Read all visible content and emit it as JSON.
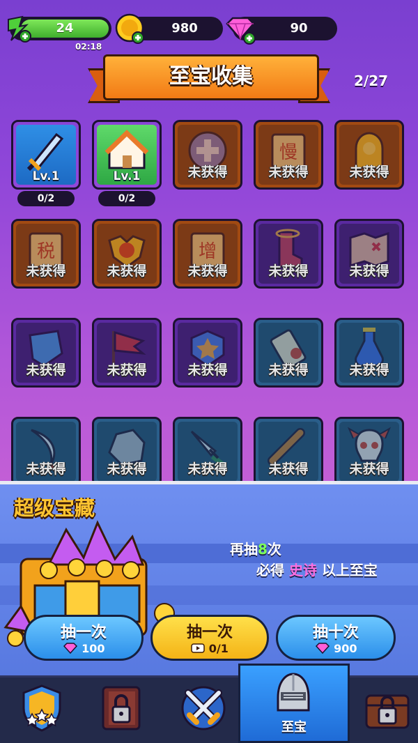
{
  "resources": {
    "energy": {
      "value": "24",
      "timer": "02:18"
    },
    "gold": {
      "value": "980"
    },
    "gems": {
      "value": "90"
    }
  },
  "header": {
    "title": "至宝收集",
    "progress": "2/27"
  },
  "collection": {
    "items": [
      {
        "icon": "sword-icon",
        "rarity": "blue",
        "owned": true,
        "level": "Lv.1",
        "count": "0/2"
      },
      {
        "icon": "house-icon",
        "rarity": "green",
        "owned": true,
        "level": "Lv.1",
        "count": "0/2"
      },
      {
        "icon": "medical-plus-icon",
        "rarity": "orange",
        "owned": false,
        "status": "未获得"
      },
      {
        "icon": "slow-scroll-icon",
        "rarity": "orange",
        "owned": false,
        "status": "未获得"
      },
      {
        "icon": "golden-armor-icon",
        "rarity": "orange",
        "owned": false,
        "status": "未获得"
      },
      {
        "icon": "tax-scroll-icon",
        "rarity": "orange",
        "owned": false,
        "status": "未获得"
      },
      {
        "icon": "trophy-emblem-icon",
        "rarity": "orange",
        "owned": false,
        "status": "未获得"
      },
      {
        "icon": "increase-scroll-icon",
        "rarity": "orange",
        "owned": false,
        "status": "未获得"
      },
      {
        "icon": "winged-boot-icon",
        "rarity": "purple",
        "owned": false,
        "status": "未获得"
      },
      {
        "icon": "treasure-map-icon",
        "rarity": "purple",
        "owned": false,
        "status": "未获得"
      },
      {
        "icon": "shield-icon",
        "rarity": "purple",
        "owned": false,
        "status": "未获得"
      },
      {
        "icon": "flag-icon",
        "rarity": "purple",
        "owned": false,
        "status": "未获得"
      },
      {
        "icon": "star-badge-icon",
        "rarity": "purple",
        "owned": false,
        "status": "未获得"
      },
      {
        "icon": "scroll-icon",
        "rarity": "teal",
        "owned": false,
        "status": "未获得"
      },
      {
        "icon": "potion-icon",
        "rarity": "teal",
        "owned": false,
        "status": "未获得"
      },
      {
        "icon": "curved-blade-icon",
        "rarity": "teal",
        "owned": false,
        "status": "未获得"
      },
      {
        "icon": "rock-icon",
        "rarity": "teal",
        "owned": false,
        "status": "未获得"
      },
      {
        "icon": "dagger-icon",
        "rarity": "teal",
        "owned": false,
        "status": "未获得"
      },
      {
        "icon": "telescope-icon",
        "rarity": "teal",
        "owned": false,
        "status": "未获得"
      },
      {
        "icon": "demon-skull-icon",
        "rarity": "teal",
        "owned": false,
        "status": "未获得"
      }
    ]
  },
  "treasure": {
    "title": "超级宝藏",
    "hint_prefix": "再抽",
    "hint_count": "8",
    "hint_suffix": "次",
    "hint2_prefix": "必得",
    "hint2_rarity": "史诗",
    "hint2_suffix": "以上至宝",
    "buttons": [
      {
        "label": "抽一次",
        "cost": "100",
        "cost_icon": "gem-icon"
      },
      {
        "label": "抽一次",
        "cost": "0/1",
        "cost_icon": "video-icon"
      },
      {
        "label": "抽十次",
        "cost": "900",
        "cost_icon": "gem-icon"
      }
    ]
  },
  "nav": {
    "tabs": [
      {
        "icon": "stars-shield-icon",
        "label": ""
      },
      {
        "icon": "locked-book-icon",
        "label": ""
      },
      {
        "icon": "crossed-swords-icon",
        "label": ""
      },
      {
        "icon": "knight-helmet-icon",
        "label": "至宝",
        "active": true
      },
      {
        "icon": "locked-chest-icon",
        "label": ""
      }
    ]
  },
  "colors": {
    "accent_green": "#7dff5a",
    "accent_pink": "#ff6fe0",
    "title_gold": "#ffc531"
  }
}
